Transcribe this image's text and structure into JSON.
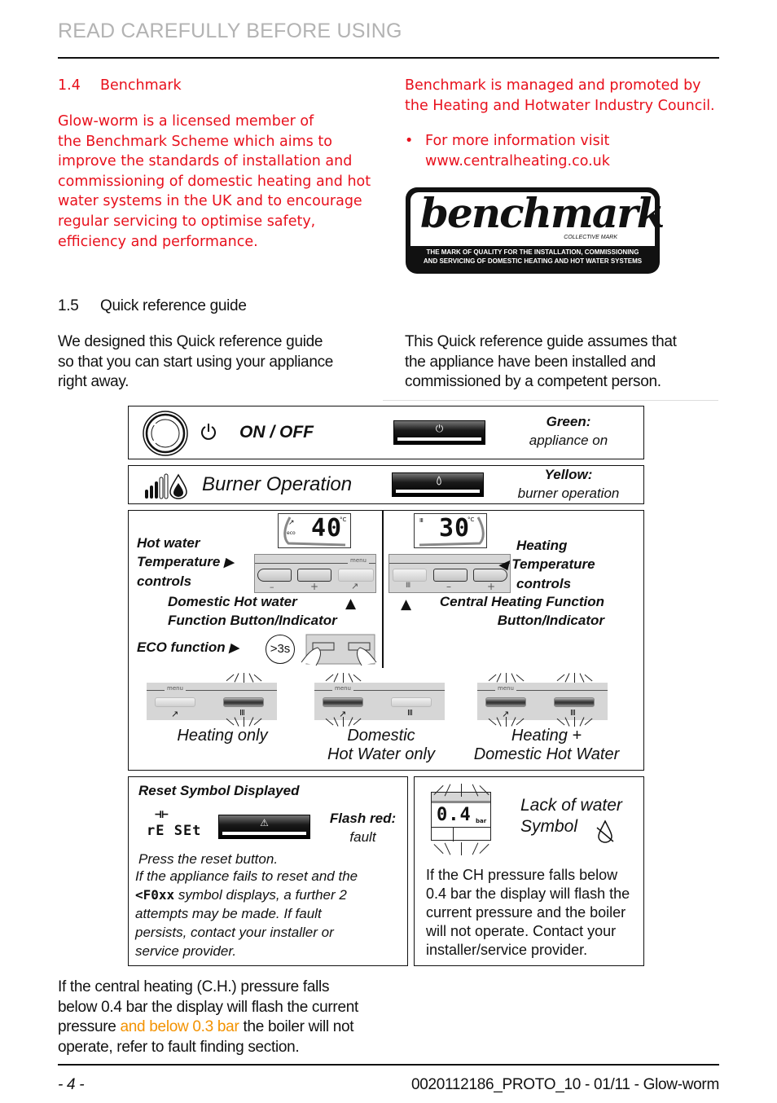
{
  "header": {
    "title": "READ CAREFULLY BEFORE USING"
  },
  "section_1_4": {
    "number": "1.4",
    "title": "Benchmark",
    "paragraph_lines": [
      "Glow-worm is a licensed member of",
      "the Benchmark Scheme which aims to",
      "improve the standards of installation and",
      "commissioning of domestic heating and hot",
      "water systems in the UK and to encourage",
      "regular servicing to optimise safety,",
      "efficiency and performance."
    ],
    "right_lines": [
      "Benchmark is managed and promoted by",
      "the Heating and Hotwater Industry Council."
    ],
    "bullet": "•",
    "bullet_lines": [
      "For more information visit",
      "www.centralheating.co.uk"
    ],
    "logo": {
      "word": "benchmark",
      "subtitle": "COLLECTIVE MARK",
      "tagline_lines": [
        "THE MARK OF QUALITY FOR THE INSTALLATION, COMMISSIONING",
        "AND SERVICING OF DOMESTIC HEATING AND HOT WATER SYSTEMS"
      ]
    }
  },
  "section_1_5": {
    "number": "1.5",
    "title": "Quick reference guide",
    "left_lines": [
      "We designed this Quick reference guide",
      "so that you can start using your appliance",
      "right away."
    ],
    "right_lines": [
      "This Quick reference guide assumes that",
      "the appliance have been installed and",
      "commissioned by a competent person."
    ]
  },
  "guide": {
    "on_off": {
      "label": "ON / OFF",
      "power_symbol": "⏻",
      "status_title": "Green:",
      "status_text": "appliance on",
      "status_color": "#2a9d3a"
    },
    "burner": {
      "label": "Burner Operation",
      "flame_symbol": "🔥",
      "status_title": "Yellow:",
      "status_text": "burner operation",
      "status_color": "#e0b000"
    },
    "hot_water": {
      "display_value": "40",
      "display_unit": "°C",
      "eco_indicator": "eco",
      "label_lines": [
        "Hot water",
        "Temperature",
        "controls"
      ],
      "menu_label": "menu",
      "minus": "–",
      "plus": "+",
      "dhw_lines": [
        "Domestic Hot water",
        "Function Button/Indicator"
      ],
      "eco_label": "ECO function",
      "eco_timer": ">3s"
    },
    "heating": {
      "display_value": "30",
      "display_unit": "°C",
      "label_lines": [
        "Heating",
        "Temperature",
        "controls"
      ],
      "minus": "–",
      "plus": "+",
      "ch_lines": [
        "Central Heating Function",
        "Button/Indicator"
      ]
    },
    "modes": [
      {
        "caption_lines": [
          "Heating only"
        ],
        "menu_label": "menu",
        "dhw_lit": false,
        "ch_lit": true
      },
      {
        "caption_lines": [
          "Domestic",
          "Hot Water only"
        ],
        "menu_label": "menu",
        "dhw_lit": true,
        "ch_lit": false
      },
      {
        "caption_lines": [
          "Heating +",
          "Domestic Hot Water"
        ],
        "menu_label": "menu",
        "dhw_lit": true,
        "ch_lit": true
      }
    ],
    "reset": {
      "title": "Reset Symbol Displayed",
      "display_top": "⊣⊢",
      "display_text": "rE SEt",
      "warning_symbol": "⚠",
      "status_title": "Flash red:",
      "status_text": "fault",
      "status_color": "#d01010",
      "press_text": "Press the reset button.",
      "line1": "If the appliance fails to reset and the",
      "fault_code": "<F0xx",
      "line2_suffix": "symbol displays, a further 2",
      "line3": "attempts may be made. If fault",
      "line4": "persists, contact your installer or",
      "line5": "service provider."
    },
    "water": {
      "display_value": "0.4",
      "display_unit": "bar",
      "title_lines": [
        "Lack of water",
        "Symbol"
      ],
      "text_lines": [
        "If the CH pressure falls below",
        "0.4 bar the display will flash the",
        "current pressure and the boiler",
        "will not operate. Contact your",
        "installer/service provider."
      ]
    }
  },
  "bottom_note": {
    "line1": "If the central heating (C.H.) pressure falls",
    "line2": "below 0.4 bar the display will flash the current",
    "line3_start": "pressure ",
    "line3_highlight": "and below 0.3 bar",
    "line3_end": " the boiler will not",
    "line4": "operate, refer to fault finding section.",
    "highlight_color": "#f39200"
  },
  "footer": {
    "page": "- 4 -",
    "doc_ref": "0020112186_PROTO_10 - 01/11 - Glow-worm"
  }
}
